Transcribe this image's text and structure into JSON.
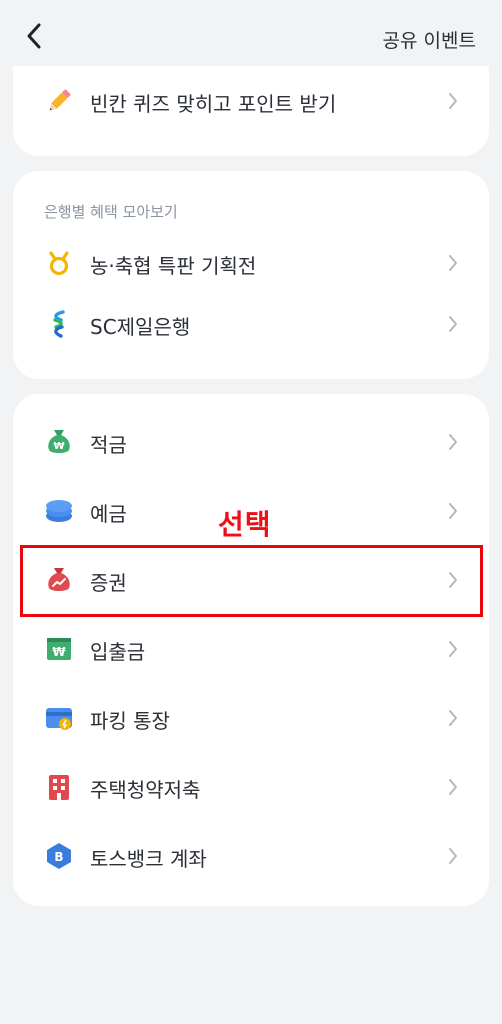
{
  "header": {
    "share_label": "공유 이벤트"
  },
  "top_card": {
    "items": [
      {
        "label": "빈칸 퀴즈 맞히고 포인트 받기",
        "icon": "pencil-icon"
      }
    ]
  },
  "banks_card": {
    "title": "은행별 혜택 모아보기",
    "items": [
      {
        "label": "농·축협 특판 기획전",
        "icon": "nh-logo-icon"
      },
      {
        "label": "SC제일은행",
        "icon": "sc-logo-icon"
      }
    ]
  },
  "accounts_card": {
    "items": [
      {
        "label": "적금",
        "icon": "money-bag-won-icon"
      },
      {
        "label": "예금",
        "icon": "coin-stack-icon"
      },
      {
        "label": "증권",
        "icon": "stock-bag-icon"
      },
      {
        "label": "입출금",
        "icon": "won-bill-icon"
      },
      {
        "label": "파킹 통장",
        "icon": "parking-account-icon"
      },
      {
        "label": "주택청약저축",
        "icon": "building-icon"
      },
      {
        "label": "토스뱅크 계좌",
        "icon": "toss-bank-icon"
      }
    ]
  },
  "annotation": {
    "text": "선택",
    "color": "#ef0e16"
  },
  "colors": {
    "background": "#f2f3f5",
    "card": "#ffffff",
    "text": "#2b2f36",
    "subtext": "#8b95a1",
    "chevron": "#b0b8c1",
    "highlight": "#e8060f"
  }
}
